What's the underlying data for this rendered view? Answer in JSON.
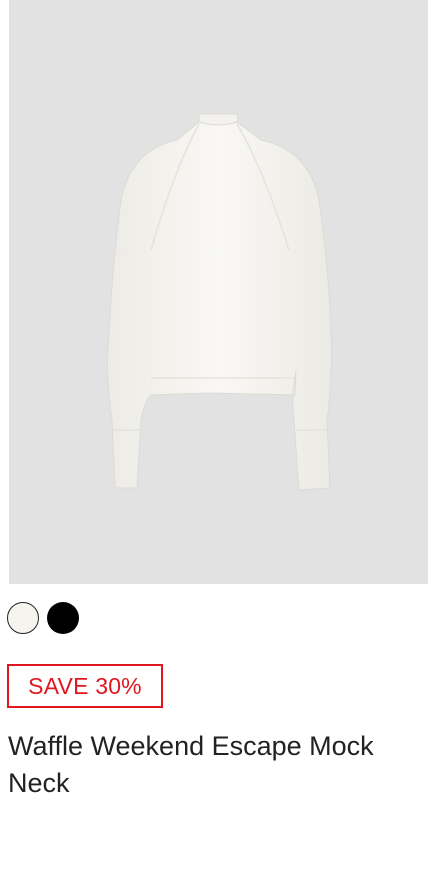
{
  "product": {
    "image_icon": "sweater-image",
    "swatches": [
      {
        "color_name": "ivory",
        "hex": "#f6f4ef"
      },
      {
        "color_name": "black",
        "hex": "#000000"
      }
    ],
    "badge": {
      "label": "SAVE 30%",
      "color": "#e0171f"
    },
    "title": "Waffle Weekend Escape Mock Neck"
  }
}
